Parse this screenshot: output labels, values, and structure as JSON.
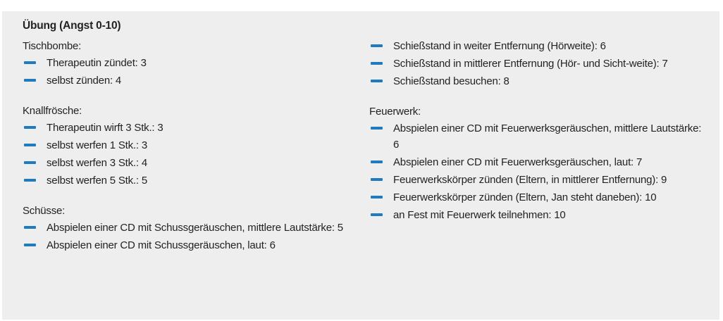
{
  "title": "Übung (Angst 0-10)",
  "columns": [
    {
      "groups": [
        {
          "heading": "Tischbombe:",
          "items": [
            "Therapeutin zündet: 3",
            "selbst zünden: 4"
          ]
        },
        {
          "heading": "Knallfrösche:",
          "items": [
            "Therapeutin wirft 3 Stk.: 3",
            "selbst werfen 1 Stk.: 3",
            "selbst werfen 3 Stk.: 4",
            "selbst werfen 5 Stk.: 5"
          ]
        },
        {
          "heading": "Schüsse:",
          "items": [
            "Abspielen einer CD mit Schussgeräuschen, mittlere Lautstärke: 5",
            "Abspielen einer CD mit Schussgeräuschen, laut: 6"
          ]
        }
      ]
    },
    {
      "groups": [
        {
          "heading": "",
          "items": [
            "Schießstand in weiter Entfernung (Hörweite): 6",
            "Schießstand in mittlerer Entfernung (Hör- und Sicht-weite): 7",
            "Schießstand besuchen: 8"
          ]
        },
        {
          "heading": "Feuerwerk:",
          "items": [
            "Abspielen einer CD mit Feuerwerksgeräuschen, mittlere Lautstärke: 6",
            "Abspielen einer CD mit Feuerwerksgeräuschen, laut: 7",
            "Feuerwerkskörper zünden (Eltern, in mittlerer Entfernung): 9",
            "Feuerwerkskörper zünden (Eltern, Jan steht daneben): 10",
            "an Fest mit Feuerwerk teilnehmen: 10"
          ]
        }
      ]
    }
  ]
}
